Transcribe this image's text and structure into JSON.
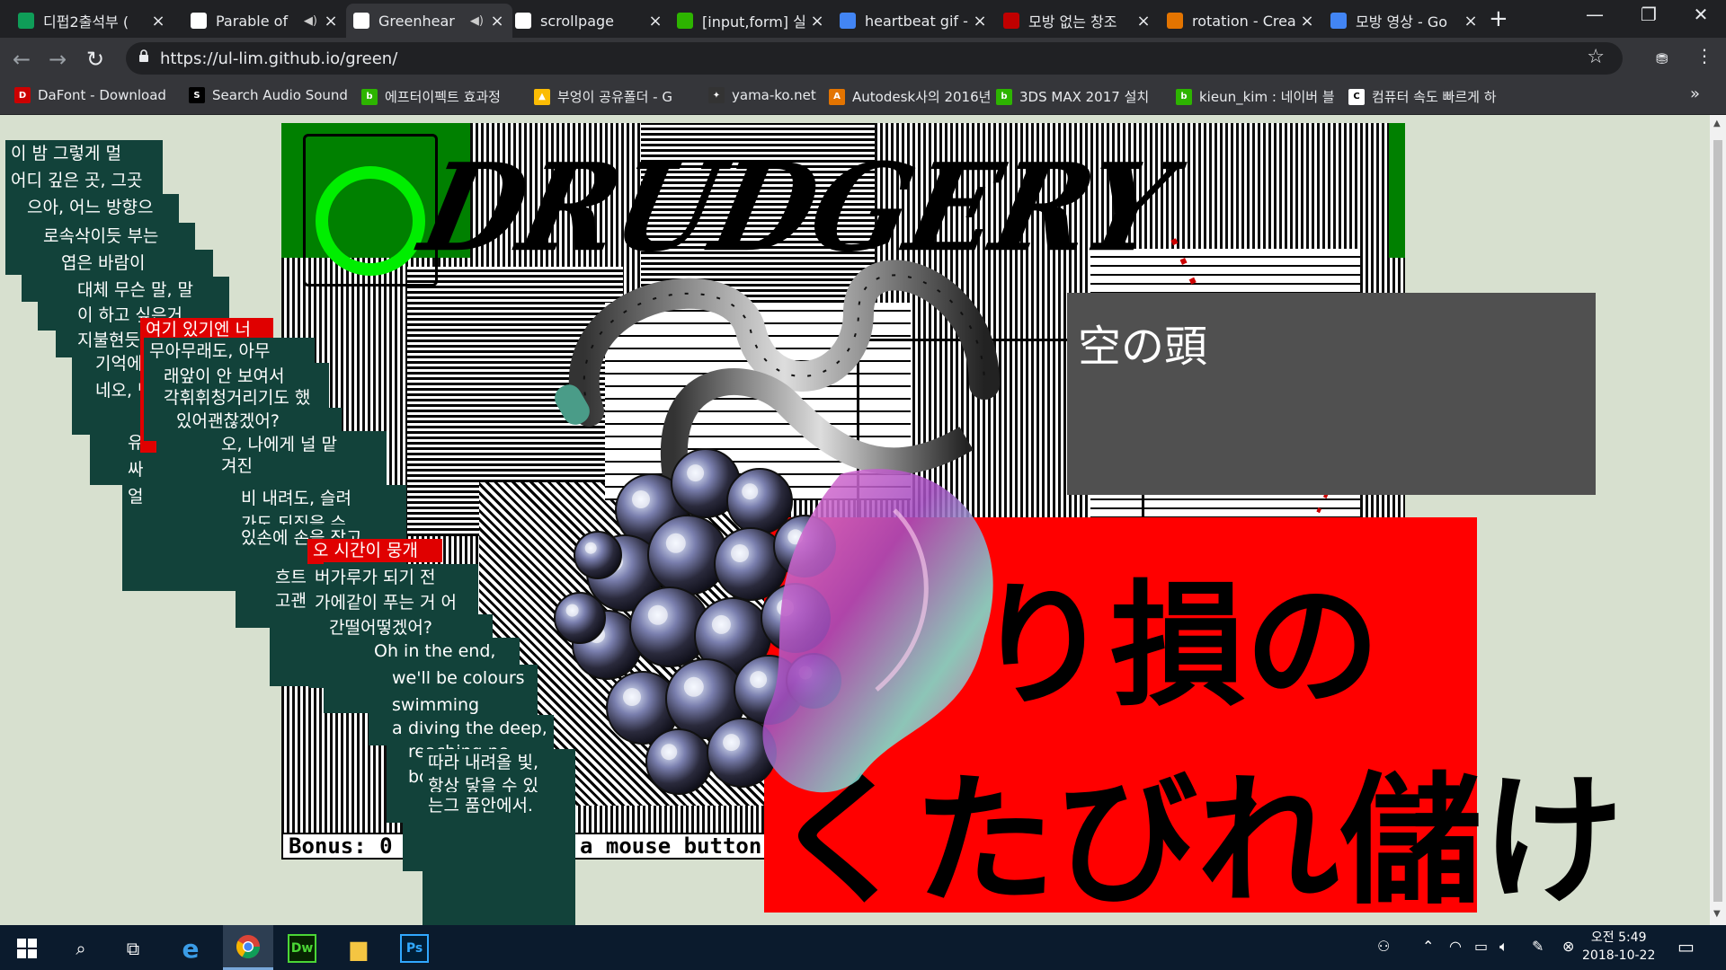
{
  "browser": {
    "tabs": [
      {
        "title": "디펍2출석부 (",
        "favicon_color": "#0f9d58",
        "favicon": "sheets-icon",
        "audio": false
      },
      {
        "title": "Parable of",
        "favicon_color": "#ffffff",
        "favicon": "page-icon",
        "audio": true
      },
      {
        "title": "Greenhear",
        "favicon_color": "#ffffff",
        "favicon": "page-icon",
        "audio": true,
        "active": true
      },
      {
        "title": "scrollpage",
        "favicon_color": "#ffffff",
        "favicon": "page-icon",
        "audio": false
      },
      {
        "title": "[input,form] 실",
        "favicon_color": "#2db400",
        "favicon": "chat-icon",
        "audio": false
      },
      {
        "title": "heartbeat gif -",
        "favicon_color": "#4285f4",
        "favicon": "google-icon",
        "audio": false
      },
      {
        "title": "모방 없는 창조",
        "favicon_color": "#c00000",
        "favicon": "doc-icon",
        "audio": false
      },
      {
        "title": "rotation - Crea",
        "favicon_color": "#e37400",
        "favicon": "blog-icon",
        "audio": false
      },
      {
        "title": "모방 영상 - Go",
        "favicon_color": "#4285f4",
        "favicon": "google-icon",
        "audio": false
      }
    ],
    "url": "https://ul-lim.github.io/green/",
    "bookmarks": [
      {
        "label": "DaFont - Download",
        "color": "#cc0000",
        "icon": "D"
      },
      {
        "label": "Search Audio Sound",
        "color": "#000000",
        "icon": "S"
      },
      {
        "label": "에프터이펙트 효과정",
        "color": "#2db400",
        "icon": "b"
      },
      {
        "label": "부엉이 공유폴더 - G",
        "color": "#fbbc04",
        "icon": "▲"
      },
      {
        "label": "yama-ko.net",
        "color": "#333333",
        "icon": "✦"
      },
      {
        "label": "Autodesk사의 2016년",
        "color": "#e37400",
        "icon": "A"
      },
      {
        "label": "3DS MAX 2017 설치",
        "color": "#2db400",
        "icon": "b"
      },
      {
        "label": "kieun_kim : 네이버 블",
        "color": "#2db400",
        "icon": "b"
      },
      {
        "label": "컴퓨터 속도 빠르게 하",
        "color": "#ffffff",
        "icon": "C"
      }
    ],
    "bookmarks_more": "»"
  },
  "page": {
    "headline": "DRUDGERY",
    "grey_box_text": "空の頭",
    "jp_line1": "り損の",
    "jp_line2": "くたびれ儲け",
    "bonus_text": "Bonus: 0",
    "mouse_text": "a mouse button",
    "stack_boxes": [
      "이 밤 그렇게 멀",
      "어디 깊은 곳, 그곳",
      "으아, 어느 방향으",
      "로속삭이듯 부는",
      "엽은 바람이",
      "대체 무슨 말, 말",
      "이 하고 싶은거",
      "지불현듯 스쳐가는",
      "기억에",
      "네오, 난",
      "유",
      "싸",
      "얼"
    ],
    "red_label_1": "여기 있기엔 너",
    "mid_boxes": [
      "무아무래도, 아무",
      "래앞이 안 보여서",
      "각휘휘청거리기도 했",
      "있어괜찮겠어?",
      "오, 나에게 널 맡",
      "겨진",
      "비 내려도, 슬려",
      "가도 되짚을 수",
      "있손에 손을 잡고"
    ],
    "red_label_2": "오 시간이 뭉개",
    "lower_boxes": [
      "흐트",
      "고괜",
      "버가루가 되기 전",
      "가에같이 푸는 거 어",
      "간떨어떻겠어?"
    ],
    "english_lines": [
      "Oh in the end,",
      "we'll be colours",
      "swimming",
      "al",
      "diving the deep,",
      "reaching no",
      "bo"
    ],
    "last_lines": [
      "따라 내려올 빛,",
      "항상 닿을 수 있",
      "는그 품안에서."
    ]
  },
  "taskbar": {
    "apps": [
      "start-icon",
      "search-icon",
      "task-view-icon",
      "edge-icon",
      "chrome-icon",
      "dreamweaver-icon",
      "explorer-icon",
      "photoshop-icon"
    ],
    "time": "오전 5:49",
    "date": "2018-10-22"
  }
}
